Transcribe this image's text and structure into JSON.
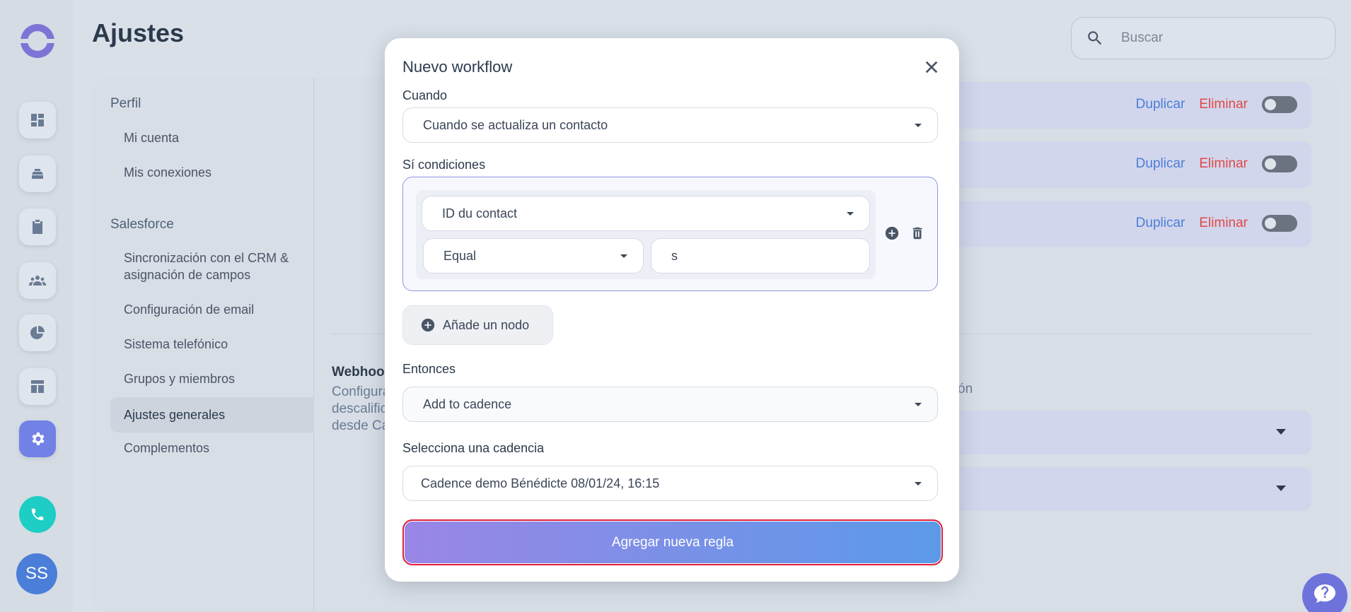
{
  "app": {
    "brand_color": "#7e74d6",
    "accent": "#7281e6"
  },
  "sidebar": {
    "nav": [
      {
        "icon": "dashboard-icon"
      },
      {
        "icon": "inbox-icon"
      },
      {
        "icon": "clipboard-icon"
      },
      {
        "icon": "people-icon"
      },
      {
        "icon": "pie-chart-icon"
      },
      {
        "icon": "layout-icon"
      },
      {
        "icon": "gear-icon",
        "active": true
      }
    ],
    "phone_icon": "phone-icon",
    "avatar_initials": "SS"
  },
  "header": {
    "title": "Ajustes",
    "search_placeholder": "Buscar"
  },
  "settings_nav": {
    "sections": [
      {
        "title": "Perfil",
        "items": [
          "Mi cuenta",
          "Mis conexiones"
        ]
      },
      {
        "title": "Salesforce",
        "items": [
          "Sincronización con el CRM & asignación de campos",
          "Configuración de email",
          "Sistema telefónico",
          "Grupos y miembros",
          "Ajustes generales",
          "Complementos"
        ]
      }
    ],
    "selected": "Ajustes generales"
  },
  "rules_list": {
    "rows": [
      {
        "duplicate": "Duplicar",
        "delete": "Eliminar",
        "enabled": false
      },
      {
        "duplicate": "Duplicar",
        "delete": "Eliminar",
        "enabled": false
      },
      {
        "duplicate": "Duplicar",
        "delete": "Eliminar",
        "enabled": false
      }
    ]
  },
  "webhooks": {
    "title": "Webhook",
    "desc_lines": [
      "Configura",
      "descalific",
      "desde Ca"
    ],
    "desc_tail": "ón"
  },
  "modal": {
    "title": "Nuevo workflow",
    "when_label": "Cuando",
    "when_value": "Cuando se actualiza un contacto",
    "conditions_label": "Sí condiciones",
    "condition": {
      "field": "ID du contact",
      "operator": "Equal",
      "value": "s"
    },
    "add_node_label": "Añade un nodo",
    "then_label": "Entonces",
    "then_value": "Add to cadence",
    "cadence_label": "Selecciona una cadencia",
    "cadence_value": "Cadence demo Bénédicte 08/01/24, 16:15",
    "submit_label": "Agregar nueva regla"
  }
}
